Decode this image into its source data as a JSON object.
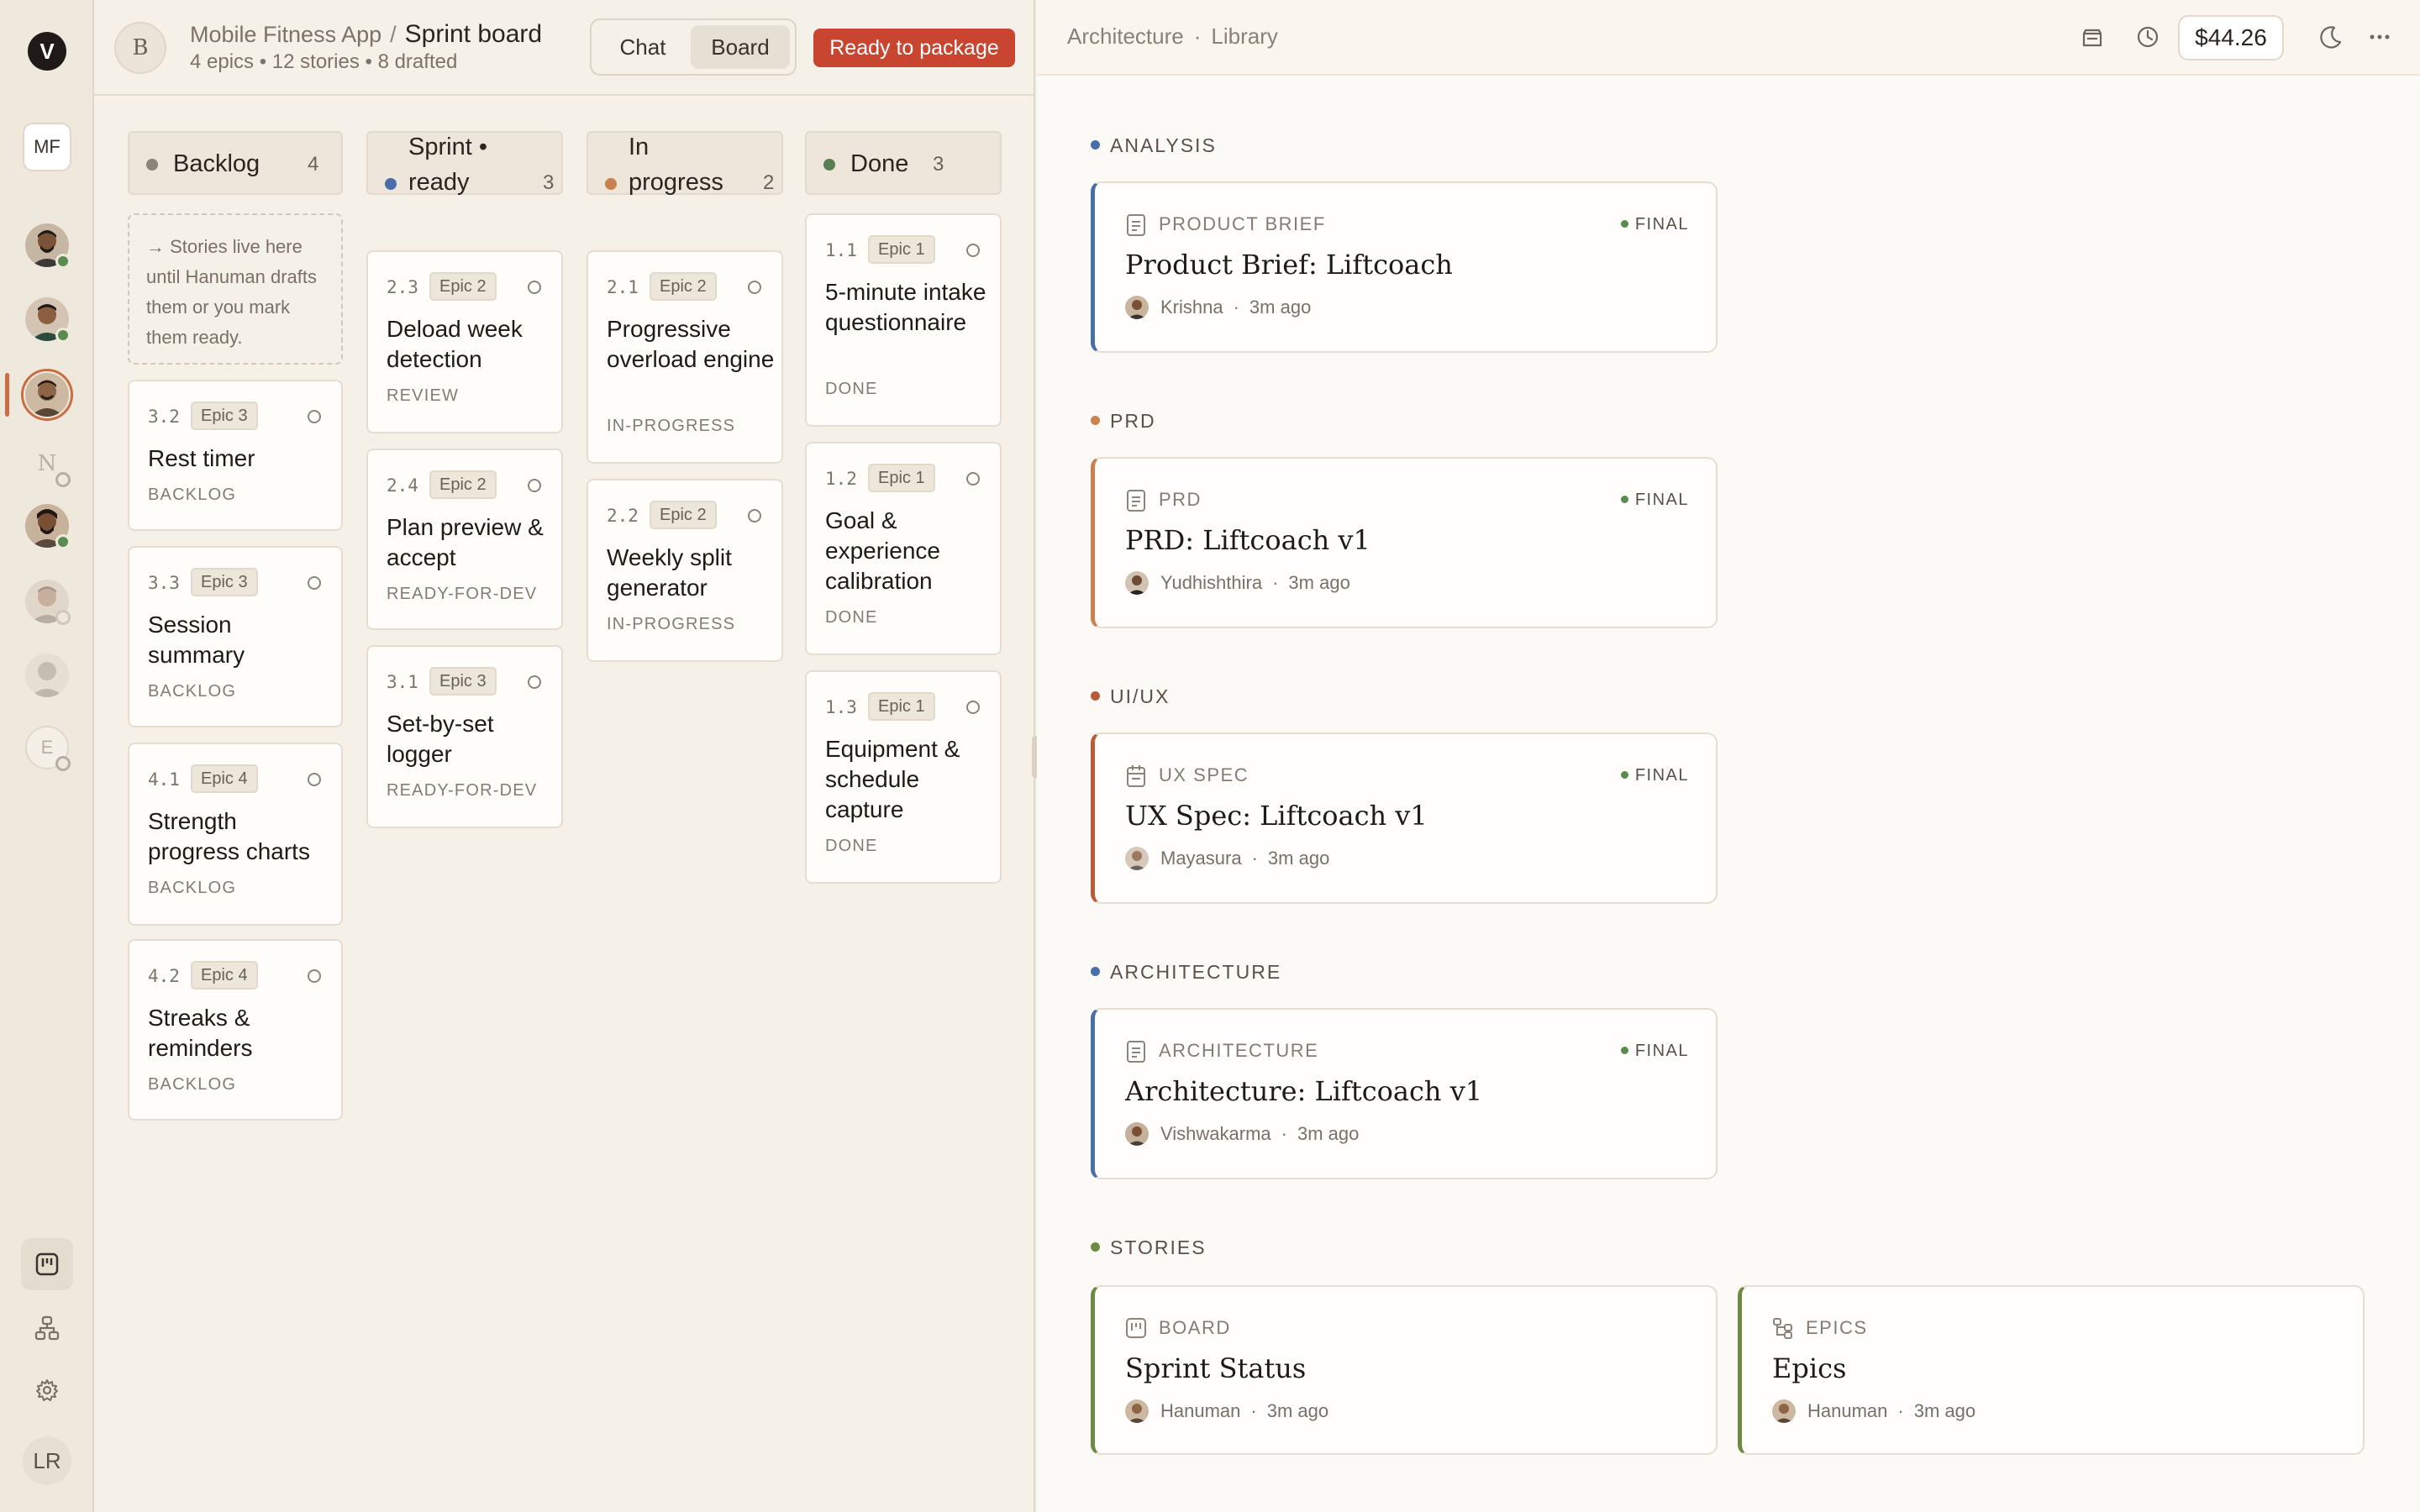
{
  "rail": {
    "logo": "V",
    "workspace": "MF",
    "agents": [
      {
        "name": "agent-1",
        "status": "online"
      },
      {
        "name": "agent-2",
        "status": "online"
      },
      {
        "name": "agent-3",
        "status": "selected"
      },
      {
        "letter": "N",
        "status": "offline"
      },
      {
        "name": "agent-5",
        "status": "online"
      },
      {
        "name": "agent-6",
        "status": "offline"
      },
      {
        "name": "agent-7",
        "status": "offline"
      },
      {
        "letter": "E",
        "status": "offline"
      }
    ],
    "tools": [
      "board-icon",
      "hierarchy-icon",
      "gear-icon"
    ],
    "user": "LR"
  },
  "board": {
    "avatar": "B",
    "project": "Mobile Fitness App",
    "page": "Sprint board",
    "separator": "/",
    "summary": "4 epics • 12 stories • 8 drafted",
    "toggle": {
      "chat": "Chat",
      "board": "Board"
    },
    "cta": "Ready to package",
    "backlog_note": "→ Stories live here until Hanuman drafts them or you mark them ready.",
    "columns": [
      {
        "title": "Backlog",
        "count": "4",
        "color": "#8c847b",
        "cards": [
          {
            "num": "3.2",
            "epic": "Epic 3",
            "title": "Rest timer",
            "status": "BACKLOG"
          },
          {
            "num": "3.3",
            "epic": "Epic 3",
            "title": "Session summary",
            "status": "BACKLOG"
          },
          {
            "num": "4.1",
            "epic": "Epic 4",
            "title": "Strength progress charts",
            "status": "BACKLOG"
          },
          {
            "num": "4.2",
            "epic": "Epic 4",
            "title": "Streaks & reminders",
            "status": "BACKLOG"
          }
        ]
      },
      {
        "title": "Sprint • ready",
        "count": "3",
        "color": "#4a6ea8",
        "cards": [
          {
            "num": "2.3",
            "epic": "Epic 2",
            "title": "Deload week detection",
            "status": "REVIEW"
          },
          {
            "num": "2.4",
            "epic": "Epic 2",
            "title": "Plan preview & accept",
            "status": "READY-FOR-DEV"
          },
          {
            "num": "3.1",
            "epic": "Epic 3",
            "title": "Set-by-set logger",
            "status": "READY-FOR-DEV"
          }
        ]
      },
      {
        "title": "In progress",
        "count": "2",
        "color": "#c9814f",
        "cards": [
          {
            "num": "2.1",
            "epic": "Epic 2",
            "title": "Progressive overload engine",
            "status": "IN-PROGRESS"
          },
          {
            "num": "2.2",
            "epic": "Epic 2",
            "title": "Weekly split generator",
            "status": "IN-PROGRESS"
          }
        ]
      },
      {
        "title": "Done",
        "count": "3",
        "color": "#5a7d52",
        "cards": [
          {
            "num": "1.1",
            "epic": "Epic 1",
            "title": "5-minute intake questionnaire",
            "status": "DONE"
          },
          {
            "num": "1.2",
            "epic": "Epic 1",
            "title": "Goal & experience calibration",
            "status": "DONE"
          },
          {
            "num": "1.3",
            "epic": "Epic 1",
            "title": "Equipment & schedule capture",
            "status": "DONE"
          }
        ]
      }
    ]
  },
  "library": {
    "crumb": [
      "Architecture",
      "Library"
    ],
    "crumb_sep": "·",
    "cost": "$44.26",
    "header_icons": [
      "package-icon",
      "history-icon",
      "moon-icon",
      "more-icon"
    ],
    "sections": [
      {
        "label": "ANALYSIS",
        "color": "#4a6ea8",
        "docs": [
          {
            "type": "PRODUCT BRIEF",
            "badge": "FINAL",
            "title": "Product Brief: Liftcoach",
            "author": "Krishna",
            "time": "3m ago",
            "accent": "#4a6ea8",
            "icon": "document-icon"
          }
        ]
      },
      {
        "label": "PRD",
        "color": "#c9814f",
        "docs": [
          {
            "type": "PRD",
            "badge": "FINAL",
            "title": "PRD: Liftcoach v1",
            "author": "Yudhishthira",
            "time": "3m ago",
            "accent": "#c9814f",
            "icon": "document-icon"
          }
        ]
      },
      {
        "label": "UI/UX",
        "color": "#b95a3a",
        "docs": [
          {
            "type": "UX SPEC",
            "badge": "FINAL",
            "title": "UX Spec: Liftcoach v1",
            "author": "Mayasura",
            "time": "3m ago",
            "accent": "#b95a3a",
            "icon": "calendar-icon"
          }
        ]
      },
      {
        "label": "ARCHITECTURE",
        "color": "#4a6ea8",
        "docs": [
          {
            "type": "ARCHITECTURE",
            "badge": "FINAL",
            "title": "Architecture: Liftcoach v1",
            "author": "Vishwakarma",
            "time": "3m ago",
            "accent": "#4a6ea8",
            "icon": "document-icon"
          }
        ]
      },
      {
        "label": "STORIES",
        "color": "#6b8a45",
        "docs": [
          {
            "type": "BOARD",
            "badge": "",
            "title": "Sprint Status",
            "author": "Hanuman",
            "time": "3m ago",
            "accent": "#6b8a45",
            "icon": "board-icon"
          },
          {
            "type": "EPICS",
            "badge": "",
            "title": "Epics",
            "author": "Hanuman",
            "time": "3m ago",
            "accent": "#6b8a45",
            "icon": "hierarchy-icon"
          }
        ]
      }
    ]
  }
}
